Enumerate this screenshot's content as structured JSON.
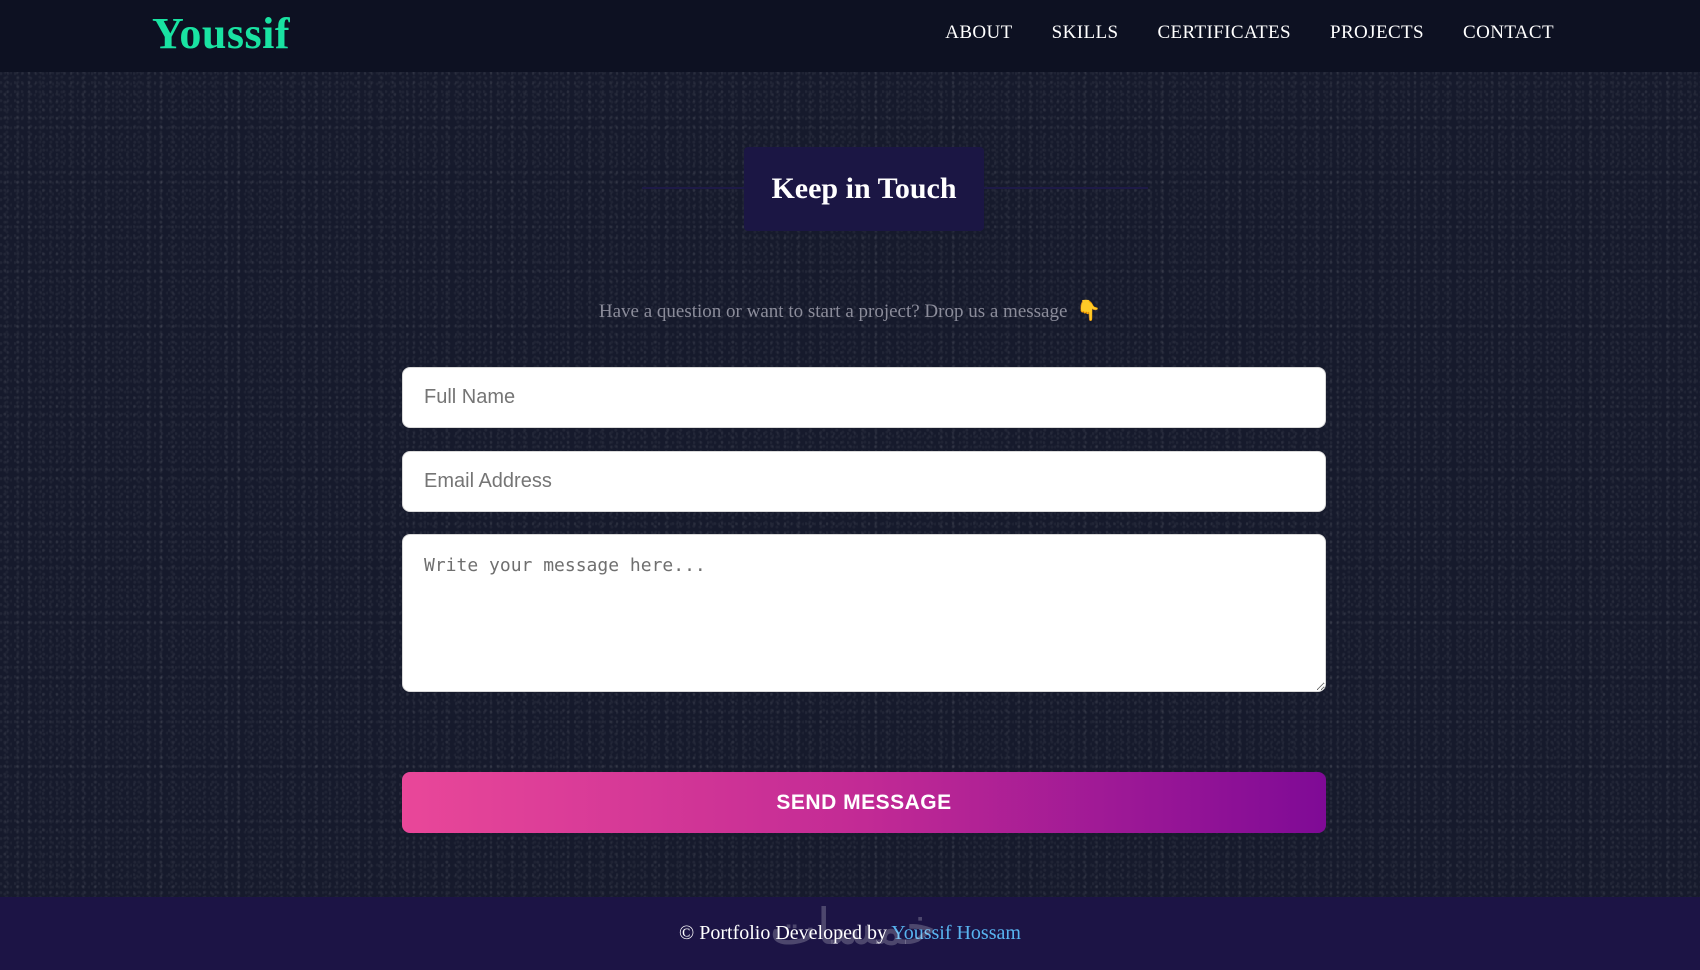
{
  "header": {
    "brand": "Youssif",
    "nav": [
      "ABOUT",
      "SKILLS",
      "CERTIFICATES",
      "PROJECTS",
      "CONTACT"
    ]
  },
  "contact": {
    "title": "Keep in Touch",
    "subtitle": "Have a question or want to start a project? Drop us a message",
    "subtitle_icon": "👇",
    "name_placeholder": "Full Name",
    "email_placeholder": "Email Address",
    "message_placeholder": "Write your message here...",
    "send_label": "SEND MESSAGE"
  },
  "footer": {
    "prefix": "© Portfolio Developed by",
    "author": "Youssif Hossam",
    "watermark": "خمسات"
  },
  "colors": {
    "brand": "#19e3a2",
    "background": "#161a2c",
    "header_bg": "#0d1122",
    "footer_bg": "#1c1445",
    "link": "#58b4f0",
    "button_gradient_start": "#e94799",
    "button_gradient_end": "#7f0a96"
  }
}
